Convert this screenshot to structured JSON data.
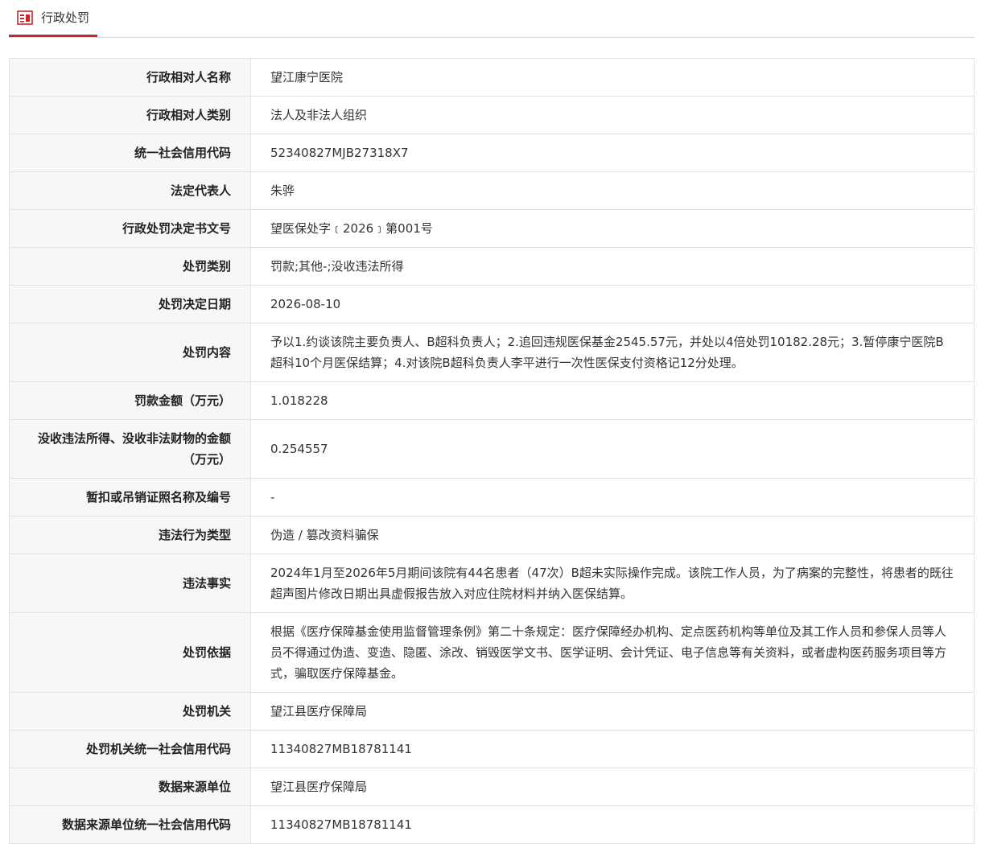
{
  "header": {
    "tab_label": "行政处罚",
    "tab_icon": "document-icon",
    "accent_color": "#c1272d"
  },
  "rows": [
    {
      "label": "行政相对人名称",
      "value": "望江康宁医院"
    },
    {
      "label": "行政相对人类别",
      "value": "法人及非法人组织"
    },
    {
      "label": "统一社会信用代码",
      "value": "52340827MJB27318X7"
    },
    {
      "label": "法定代表人",
      "value": "朱骅"
    },
    {
      "label": "行政处罚决定书文号",
      "value": "望医保处字﹝2026﹞第001号"
    },
    {
      "label": "处罚类别",
      "value": "罚款;其他-;没收违法所得"
    },
    {
      "label": "处罚决定日期",
      "value": "2026-08-10"
    },
    {
      "label": "处罚内容",
      "value": "予以1.约谈该院主要负责人、B超科负责人；2.追回违规医保基金2545.57元，并处以4倍处罚10182.28元；3.暂停康宁医院B超科10个月医保结算；4.对该院B超科负责人李平进行一次性医保支付资格记12分处理。"
    },
    {
      "label": "罚款金额（万元）",
      "value": "1.018228"
    },
    {
      "label": "没收违法所得、没收非法财物的金额（万元）",
      "value": "0.254557"
    },
    {
      "label": "暂扣或吊销证照名称及编号",
      "value": "-"
    },
    {
      "label": "违法行为类型",
      "value": "伪造 / 篡改资料骗保"
    },
    {
      "label": "违法事实",
      "value": "2024年1月至2026年5月期间该院有44名患者（47次）B超未实际操作完成。该院工作人员，为了病案的完整性，将患者的既往超声图片修改日期出具虚假报告放入对应住院材料并纳入医保结算。"
    },
    {
      "label": "处罚依据",
      "value": "根据《医疗保障基金使用监督管理条例》第二十条规定：医疗保障经办机构、定点医药机构等单位及其工作人员和参保人员等人员不得通过伪造、变造、隐匿、涂改、销毁医学文书、医学证明、会计凭证、电子信息等有关资料，或者虚构医药服务项目等方式，骗取医疗保障基金。"
    },
    {
      "label": "处罚机关",
      "value": "望江县医疗保障局"
    },
    {
      "label": "处罚机关统一社会信用代码",
      "value": "11340827MB18781141"
    },
    {
      "label": "数据来源单位",
      "value": "望江县医疗保障局"
    },
    {
      "label": "数据来源单位统一社会信用代码",
      "value": "11340827MB18781141"
    }
  ]
}
